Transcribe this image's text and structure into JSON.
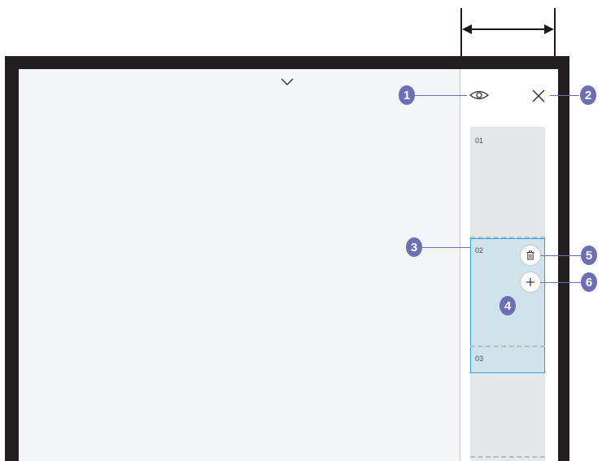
{
  "panel": {
    "pages": [
      {
        "label": "01"
      },
      {
        "label": "02"
      },
      {
        "label": "03"
      }
    ],
    "selected_page": "02"
  },
  "callouts": [
    "1",
    "2",
    "3",
    "4",
    "5",
    "6"
  ],
  "icons": {
    "collapse": "chevron-down-icon",
    "preview": "eye-icon",
    "close": "close-icon",
    "delete": "trash-icon",
    "add": "plus-icon"
  },
  "colors": {
    "frame": "#231f20",
    "screen": "#f4f5f6",
    "page_strip": "#e6e7e8",
    "selected_fill": "#d0e3ea",
    "selected_border": "#29a8e0",
    "callout": "#6c6fb5"
  }
}
